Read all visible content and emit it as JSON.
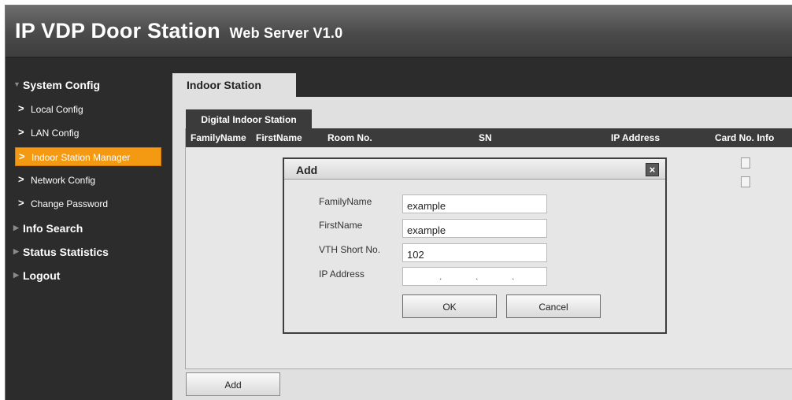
{
  "header": {
    "title": "IP VDP Door Station",
    "subtitle": "Web Server V1.0"
  },
  "sidebar": {
    "groups": [
      {
        "label": "System Config",
        "expanded": true
      },
      {
        "label": "Info Search"
      },
      {
        "label": "Status Statistics"
      },
      {
        "label": "Logout"
      }
    ],
    "items": [
      {
        "label": "Local Config"
      },
      {
        "label": "LAN Config"
      },
      {
        "label": "Indoor Station Manager",
        "active": true
      },
      {
        "label": "Network Config"
      },
      {
        "label": "Change Password"
      }
    ]
  },
  "main": {
    "tab": "Indoor Station",
    "sub_tab": "Digital Indoor Station",
    "columns": [
      "FamilyName",
      "FirstName",
      "Room No.",
      "SN",
      "IP Address",
      "Card No. Info"
    ],
    "add_button": "Add"
  },
  "dialog": {
    "title": "Add",
    "close": "×",
    "fields": [
      {
        "label": "FamilyName",
        "value": "example"
      },
      {
        "label": "FirstName",
        "value": "example"
      },
      {
        "label": "VTH Short No.",
        "value": "102"
      },
      {
        "label": "IP Address",
        "value": ""
      }
    ],
    "ok": "OK",
    "cancel": "Cancel"
  },
  "colors": {
    "accent": "#f39a12",
    "header_bg": "#4a4a4a",
    "panel_bg": "#e0e0e0"
  }
}
